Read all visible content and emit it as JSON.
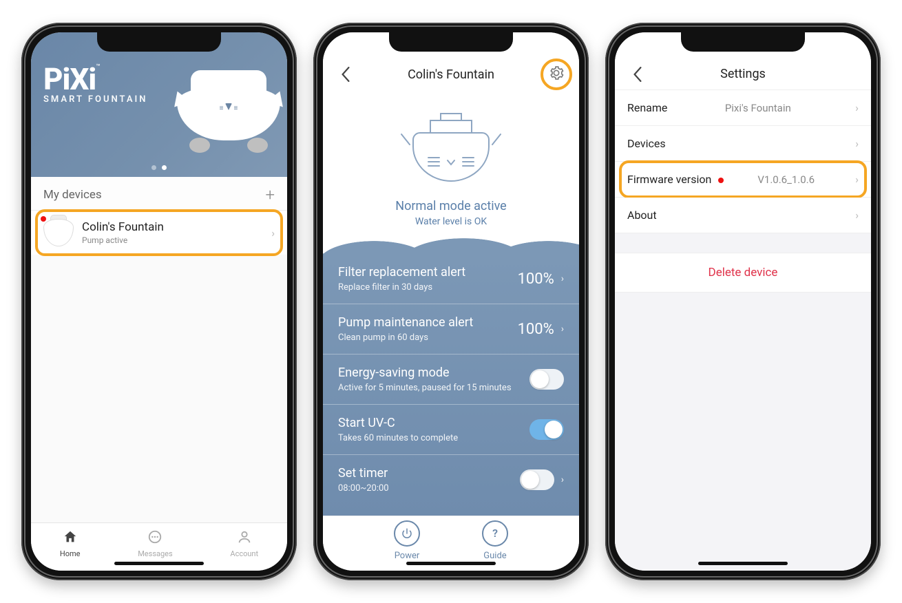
{
  "colors": {
    "accent_blue_gray": "#6f8cad",
    "highlight": "#f5a623",
    "danger": "#e0334b"
  },
  "screen1": {
    "banner": {
      "logo_main": "PiXi",
      "logo_tm": "™",
      "logo_sub": "SMART FOUNTAIN"
    },
    "section_title": "My devices",
    "add_btn": "+",
    "device": {
      "name": "Colin's Fountain",
      "status": "Pump active",
      "alert": true
    },
    "tabs": {
      "home": "Home",
      "messages": "Messages",
      "account": "Account"
    }
  },
  "screen2": {
    "title": "Colin's Fountain",
    "mode": "Normal mode active",
    "water": "Water level is OK",
    "rows": {
      "filter": {
        "t": "Filter replacement alert",
        "s": "Replace filter in 30 days",
        "val": "100%"
      },
      "pump": {
        "t": "Pump maintenance alert",
        "s": "Clean pump in 60 days",
        "val": "100%"
      },
      "energy": {
        "t": "Energy-saving mode",
        "s": "Active for 5 minutes, paused for 15 minutes",
        "on": false
      },
      "uvc": {
        "t": "Start UV-C",
        "s": "Takes 60 minutes to complete",
        "on": true
      },
      "timer": {
        "t": "Set timer",
        "s": "08:00~20:00",
        "on": false
      }
    },
    "controls": {
      "power": "Power",
      "guide": "Guide"
    }
  },
  "screen3": {
    "title": "Settings",
    "rows": {
      "rename": {
        "label": "Rename",
        "value": "Pixi's Fountain"
      },
      "devices": {
        "label": "Devices",
        "value": ""
      },
      "firmware": {
        "label": "Firmware version",
        "value": "V1.0.6_1.0.6",
        "alert": true
      },
      "about": {
        "label": "About",
        "value": ""
      }
    },
    "delete": "Delete device"
  }
}
